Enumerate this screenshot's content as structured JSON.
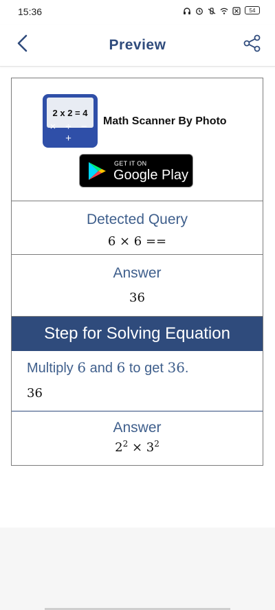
{
  "status": {
    "time": "15:36",
    "battery": "54"
  },
  "header": {
    "title": "Preview",
    "back_icon": "chevron-left-icon",
    "share_icon": "share-icon"
  },
  "promo": {
    "logo_eq": "2 x 2 = 4",
    "logo_ops": "× ÷ − +",
    "app_name": "Math Scanner By Photo",
    "badge_small": "GET IT ON",
    "badge_big": "Google Play"
  },
  "detected": {
    "heading": "Detected Query",
    "value": "6 × 6 =="
  },
  "answer1": {
    "heading": "Answer",
    "value": "36"
  },
  "steps": {
    "header": "Step for Solving Equation",
    "text_a": "Multiply ",
    "num1": "6",
    "text_b": " and ",
    "num2": "6",
    "text_c": " to get ",
    "num3": "36",
    "text_d": ".",
    "result": "36"
  },
  "answer2": {
    "heading": "Answer",
    "base1": "2",
    "exp1": "2",
    "op": " × ",
    "base2": "3",
    "exp2": "2"
  },
  "colors": {
    "accent": "#2f4b7c",
    "heading": "#3f5f8c",
    "border": "#7b7b7b"
  }
}
